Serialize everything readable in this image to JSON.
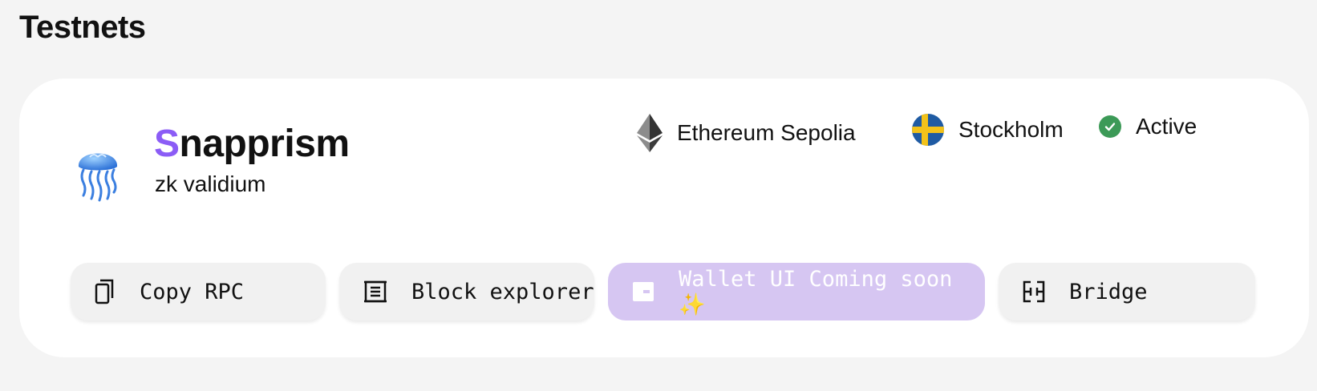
{
  "section": {
    "title": "Testnets"
  },
  "card": {
    "name_first": "S",
    "name_rest": "napprism",
    "subtitle": "zk validium",
    "network": "Ethereum Sepolia",
    "location": "Stockholm",
    "status": "Active",
    "accent_color": "#8b5cf6",
    "status_color": "#3c9a57"
  },
  "buttons": {
    "copy_rpc": "Copy RPC",
    "block_explorer": "Block explorer",
    "wallet": "Wallet UI Coming soon ✨",
    "bridge": "Bridge"
  },
  "icons": {
    "avatar": "jellyfish-icon",
    "network": "ethereum-icon",
    "location": "sweden-flag-icon",
    "status": "check-circle-icon",
    "copy": "copy-icon",
    "explorer": "block-explorer-icon",
    "wallet": "wallet-icon",
    "bridge": "bridge-icon"
  }
}
